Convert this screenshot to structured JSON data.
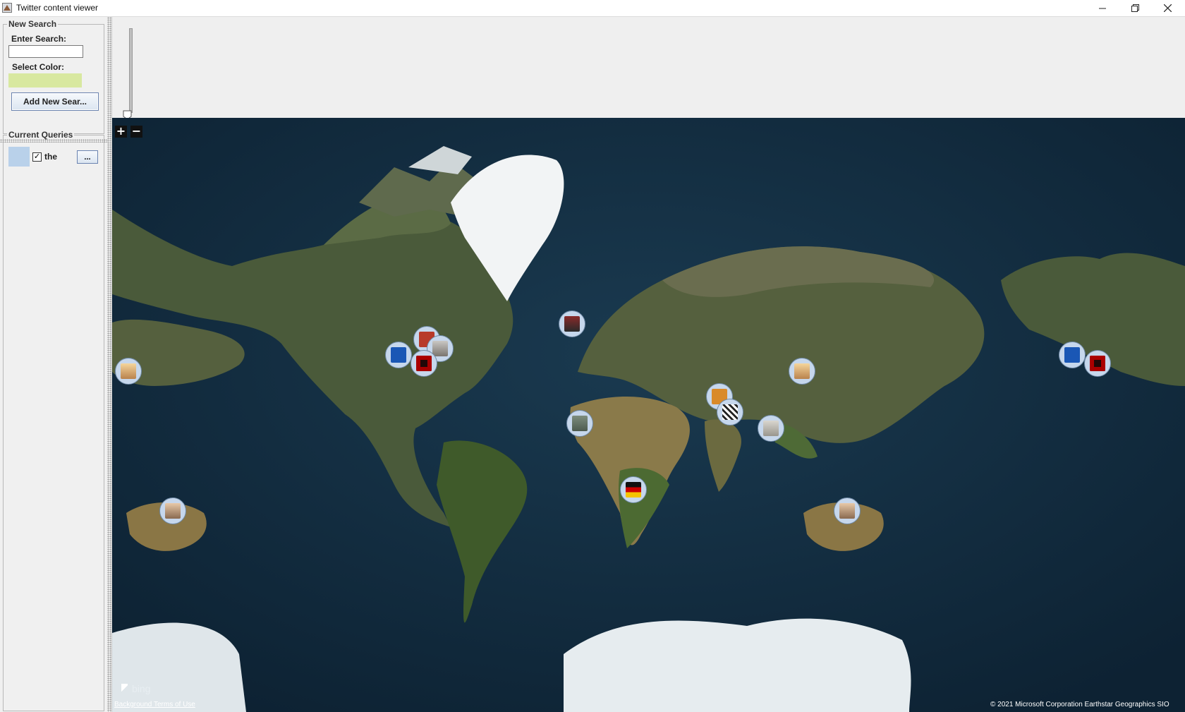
{
  "window": {
    "title": "Twitter content viewer",
    "controls": [
      "minimize",
      "restore",
      "close"
    ]
  },
  "new_search": {
    "group_title": "New Search",
    "enter_search_label": "Enter Search:",
    "search_value": "",
    "select_color_label": "Select Color:",
    "selected_color": "#d8e8a0",
    "add_button_label": "Add New Sear..."
  },
  "current_queries": {
    "group_title": "Current Queries",
    "items": [
      {
        "color": "#b9d1ea",
        "checked": true,
        "label": "the",
        "options_label": "..."
      }
    ]
  },
  "map": {
    "zoom_in_label": "+",
    "zoom_out_label": "−",
    "bing_label": "bing",
    "terms_label": "Background Terms of Use",
    "copyright": "© 2021 Microsoft Corporation Earthstar Geographics SIO",
    "tweet_markers": [
      {
        "icon": "profile-woman-icon"
      },
      {
        "icon": "royals-kc-logo-icon"
      },
      {
        "icon": "red-avatar-icon"
      },
      {
        "icon": "tower-photo-icon"
      },
      {
        "icon": "red-eye-avatar-icon"
      },
      {
        "icon": "person-photo-icon"
      },
      {
        "icon": "building-photo-icon"
      },
      {
        "icon": "orange-avatar-icon"
      },
      {
        "icon": "bw-avatar-icon"
      },
      {
        "icon": "statue-photo-icon"
      },
      {
        "icon": "flag-avatar-icon"
      },
      {
        "icon": "man-face-icon"
      },
      {
        "icon": "profile-woman-icon"
      },
      {
        "icon": "man-face-icon"
      },
      {
        "icon": "royals-kc-logo-icon"
      },
      {
        "icon": "red-eye-avatar-icon"
      }
    ]
  }
}
